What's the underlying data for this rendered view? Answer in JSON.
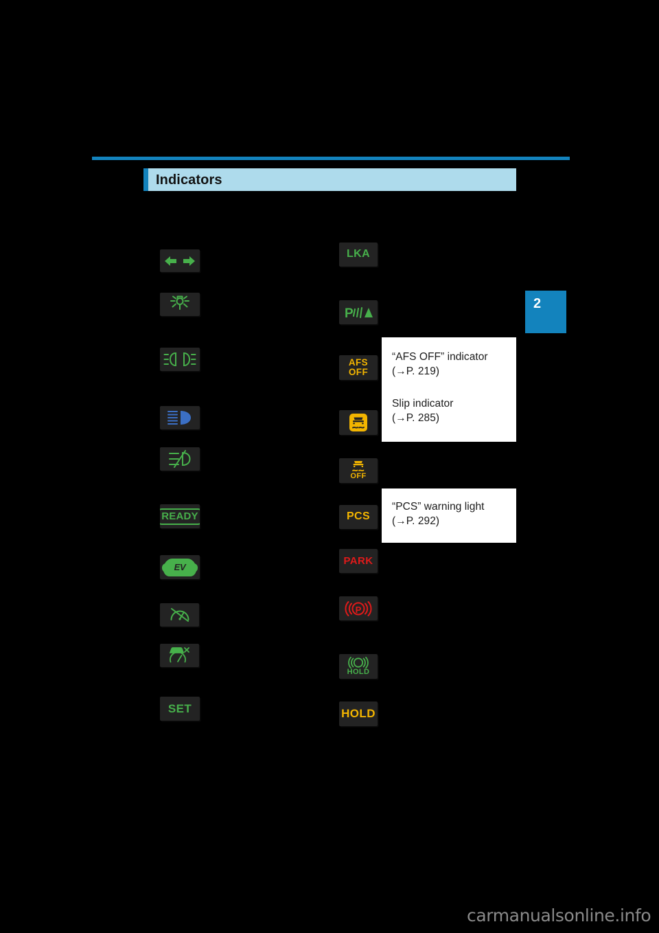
{
  "page": {
    "chapter_tab": "2",
    "section_title": "Indicators",
    "watermark": "carmanualsonline.info",
    "colors": {
      "accent_blue": "#1383bd",
      "title_bar_bg": "#aedbec",
      "chip_bg": "#232323",
      "green": "#47b04b",
      "amber": "#f3b500",
      "red": "#e01a1a",
      "blue": "#3b6fc4"
    }
  },
  "left_column": [
    {
      "id": "turn-signal",
      "icon": "turn-signal-arrows-icon",
      "label": "",
      "color": "green"
    },
    {
      "id": "tail-light",
      "icon": "tail-light-icon",
      "label": "",
      "color": "green"
    },
    {
      "id": "headlight",
      "icon": "headlight-icon",
      "label": "",
      "color": "green"
    },
    {
      "id": "high-beam",
      "icon": "high-beam-icon",
      "label": "",
      "color": "blue"
    },
    {
      "id": "front-fog-light",
      "icon": "front-fog-light-icon",
      "label": "",
      "color": "green"
    },
    {
      "id": "ready",
      "icon": "ready-badge-icon",
      "label": "READY",
      "color": "green"
    },
    {
      "id": "ev-mode",
      "icon": "ev-mode-icon",
      "label": "EV",
      "color": "green"
    },
    {
      "id": "cruise-control",
      "icon": "cruise-control-icon",
      "label": "",
      "color": "green"
    },
    {
      "id": "radar-cruise",
      "icon": "dynamic-radar-cruise-icon",
      "label": "",
      "color": "green"
    },
    {
      "id": "set",
      "icon": "set-text-icon",
      "label": "SET",
      "color": "green"
    }
  ],
  "right_column": [
    {
      "id": "lka",
      "icon": "lka-text-icon",
      "label": "LKA",
      "color": "green"
    },
    {
      "id": "parking-sonar",
      "icon": "parking-sonar-icon",
      "label": "P",
      "color": "green"
    },
    {
      "id": "afs-off",
      "icon": "afs-off-text-icon",
      "label": "AFS\nOFF",
      "color": "amber"
    },
    {
      "id": "slip",
      "icon": "slip-indicator-icon",
      "label": "",
      "color": "amber"
    },
    {
      "id": "vsc-off",
      "icon": "vsc-off-icon",
      "label": "OFF",
      "color": "amber"
    },
    {
      "id": "pcs",
      "icon": "pcs-text-icon",
      "label": "PCS",
      "color": "amber"
    },
    {
      "id": "park",
      "icon": "park-text-icon",
      "label": "PARK",
      "color": "red"
    },
    {
      "id": "brake-system",
      "icon": "brake-system-p-icon",
      "label": "P",
      "color": "red"
    },
    {
      "id": "brake-hold-green",
      "icon": "brake-hold-icon",
      "label": "HOLD",
      "color": "green"
    },
    {
      "id": "brake-hold-amber",
      "icon": "hold-text-icon",
      "label": "HOLD",
      "color": "amber"
    }
  ],
  "callouts": [
    {
      "id": "afs-slip-callout",
      "lines": [
        "“AFS OFF” indicator",
        "(→P. 219)",
        "",
        "",
        "Slip indicator",
        "(→P. 285)"
      ],
      "entries": [
        {
          "title": "“AFS OFF” indicator",
          "ref": "(→P. 219)"
        },
        {
          "title": "Slip indicator",
          "ref": "(→P. 285)"
        }
      ]
    },
    {
      "id": "pcs-callout",
      "lines": [
        "“PCS” warning light",
        "(→P. 292)"
      ],
      "entries": [
        {
          "title": "“PCS” warning light",
          "ref": "(→P. 292)"
        }
      ]
    }
  ]
}
